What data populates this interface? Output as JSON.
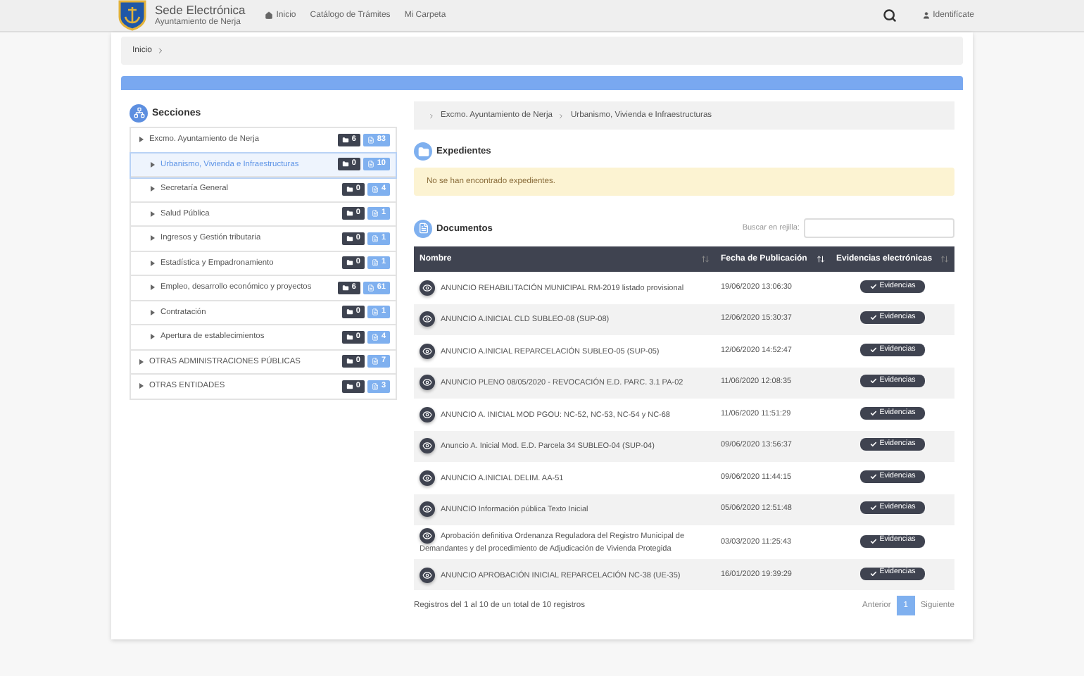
{
  "header": {
    "title": "Sede Electrónica",
    "subtitle": "Ayuntamiento de Nerja",
    "nav": [
      {
        "label": "Inicio",
        "kind": "home"
      },
      {
        "label": "Catálogo de Trámites",
        "kind": "plain"
      },
      {
        "label": "Mi Carpeta",
        "kind": "plain"
      }
    ],
    "login": "Identifícate"
  },
  "breadcrumb": [
    "Inicio"
  ],
  "sidebar": {
    "title": "Secciones",
    "items": [
      {
        "label": "Excmo. Ayuntamiento de Nerja",
        "folders": "6",
        "documents": "83",
        "selected": false,
        "children": [
          {
            "label": "Urbanismo, Vivienda e Infraestructuras",
            "folders": "0",
            "documents": "10",
            "selected": true
          },
          {
            "label": "Secretaría General",
            "folders": "0",
            "documents": "4",
            "selected": false
          },
          {
            "label": "Salud Pública",
            "folders": "0",
            "documents": "1",
            "selected": false
          },
          {
            "label": "Ingresos y Gestión tributaria",
            "folders": "0",
            "documents": "1",
            "selected": false
          },
          {
            "label": "Estadística y Empadronamiento",
            "folders": "0",
            "documents": "1",
            "selected": false
          },
          {
            "label": "Empleo, desarrollo económico y proyectos",
            "folders": "6",
            "documents": "61",
            "selected": false
          },
          {
            "label": "Contratación",
            "folders": "0",
            "documents": "1",
            "selected": false
          },
          {
            "label": "Apertura de establecimientos",
            "folders": "0",
            "documents": "4",
            "selected": false
          }
        ]
      },
      {
        "label": "OTRAS ADMINISTRACIONES PÚBLICAS",
        "folders": "0",
        "documents": "7",
        "selected": false
      },
      {
        "label": "OTRAS ENTIDADES",
        "folders": "0",
        "documents": "3",
        "selected": false
      }
    ]
  },
  "path": [
    "Excmo. Ayuntamiento de Nerja",
    "Urbanismo, Vivienda e Infraestructuras"
  ],
  "expedientes": {
    "title": "Expedientes",
    "message": "No se han encontrado expedientes."
  },
  "documents": {
    "title": "Documentos",
    "search_label": "Buscar en rejilla:",
    "columns": [
      {
        "label": "Nombre",
        "sorted": false
      },
      {
        "label": "Fecha de Publicación",
        "sorted": true
      },
      {
        "label": "Evidencias electrónicas",
        "sorted": false
      }
    ],
    "rows": [
      {
        "name": "ANUNCIO REHABILITACIÓN MUNICIPAL RM-2019 listado provisional",
        "date": "19/06/2020 13:06:30",
        "action": "Evidencias"
      },
      {
        "name": "ANUNCIO A.INICIAL CLD SUBLEO-08 (SUP-08)",
        "date": "12/06/2020 15:30:37",
        "action": "Evidencias"
      },
      {
        "name": "ANUNCIO A.INICIAL REPARCELACIÓN SUBLEO-05 (SUP-05)",
        "date": "12/06/2020 14:52:47",
        "action": "Evidencias"
      },
      {
        "name": "ANUNCIO PLENO 08/05/2020 - REVOCACIÓN E.D. PARC. 3.1 PA-02",
        "date": "11/06/2020 12:08:35",
        "action": "Evidencias"
      },
      {
        "name": "ANUNCIO A. INICIAL MOD PGOU: NC-52, NC-53, NC-54 y NC-68",
        "date": "11/06/2020 11:51:29",
        "action": "Evidencias"
      },
      {
        "name": "Anuncio A. Inicial Mod. E.D. Parcela 34 SUBLEO-04 (SUP-04)",
        "date": "09/06/2020 13:56:37",
        "action": "Evidencias"
      },
      {
        "name": "ANUNCIO A.INICIAL DELIM. AA-51",
        "date": "09/06/2020 11:44:15",
        "action": "Evidencias"
      },
      {
        "name": "ANUNCIO Información pública Texto Inicial",
        "date": "05/06/2020 12:51:48",
        "action": "Evidencias"
      },
      {
        "name": "Aprobación definitiva Ordenanza Reguladora del Registro Municipal de Demandantes y del procedimiento de Adjudicación de Vivienda Protegida",
        "date": "03/03/2020 11:25:43",
        "action": "Evidencias"
      },
      {
        "name": "ANUNCIO APROBACIÓN INICIAL REPARCELACIÓN NC-38 (UE-35)",
        "date": "16/01/2020 19:39:29",
        "action": "Evidencias"
      }
    ],
    "summary": "Registros del 1 al 10 de un total de 10 registros",
    "pagination": {
      "previous": "Anterior",
      "pages": [
        {
          "label": "1",
          "selected": true
        }
      ],
      "next": "Siguiente"
    }
  }
}
